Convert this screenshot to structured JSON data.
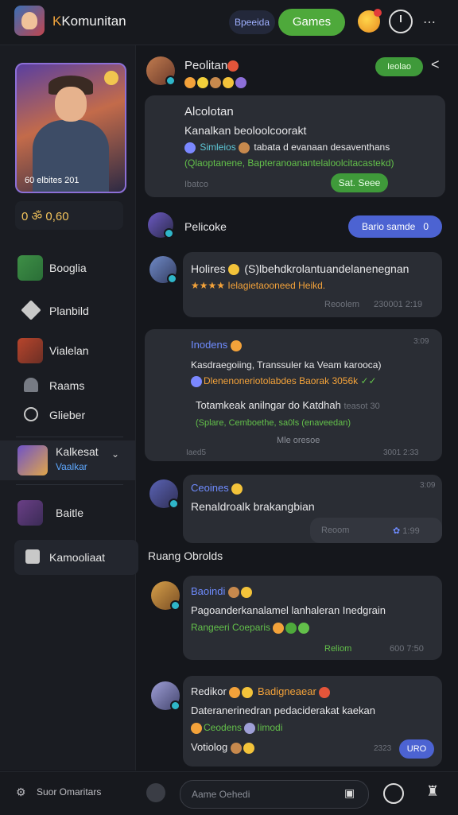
{
  "header": {
    "title": "Komunitan",
    "pill_label": "Bpeeida",
    "games_label": "Games",
    "icons": [
      "app-logo",
      "badge-icon",
      "timer-icon",
      "menu-icon"
    ],
    "accent": "#4ea93b"
  },
  "sidebar": {
    "hero_label": "60 elbites 201",
    "stats": "0 ॐ 0,60",
    "items": [
      {
        "label": "Booglia"
      },
      {
        "label": "Planbild"
      },
      {
        "label": "Vialelan"
      },
      {
        "label": "Raams"
      },
      {
        "label": "Glieber"
      },
      {
        "label": "Kalkesat",
        "sub": "Vaalkar"
      },
      {
        "label": "Baitle"
      },
      {
        "label": "Kamooliaat"
      }
    ]
  },
  "feed": {
    "post1": {
      "name": "Peolitan",
      "follow_label": "Ieolao",
      "title": "Alcolotan",
      "line1": "Kanalkan beoloolcoorakt",
      "line2a": "Simleios",
      "line2b": "tabata d evanaan desaventhans",
      "line3": "(Qlaoptanene, Bapteranoanantelaloolcitacastekd)",
      "footer_left": "Ibatco",
      "button": "Sat. Seee"
    },
    "section1": {
      "name": "Pelicoke",
      "button": "Bario samde",
      "count": "0"
    },
    "post2": {
      "name": "Holires",
      "text": "(S)lbehdkrolantuandelanenegnan",
      "sub": "Ielagietaooneed Heikd.",
      "footer_left": "Reoolem",
      "footer_right": "230001 2:19"
    },
    "post3": {
      "name": "Inodens",
      "time": "3:09",
      "line1": "Kasdraegoiing, Transsuler ka Veam karooca)",
      "line2": "Dlenenoneriotolabdes Baorak 3056k",
      "inner1": "Totamkeak anilngar do Katdhah",
      "inner1_time": "teasot 30",
      "inner2": "(Splare, Cemboethe, sa0ls (enaveedan)",
      "inner3": "Mle oresoe",
      "footer_left": "Iaed5",
      "footer_right": "3001 2:33"
    },
    "post4": {
      "name": "Ceoines",
      "time": "3:09",
      "text": "Renaldroalk brakangbian",
      "footer_left": "Reoom",
      "footer_right": "1:99"
    },
    "room_label": "Ruang Obrolds",
    "post5": {
      "name": "Baoindi",
      "text": "Pagoanderkanalamel lanhaleran Inedgrain",
      "sub": "Rangeeri Coeparis",
      "footer_left": "Reliom",
      "footer_right": "600 7:50"
    },
    "post6": {
      "name": "Redikor",
      "name2": "Badigneaear",
      "text": "Dateranerinedran pedaciderakat kaekan",
      "sub1": "Ceodens",
      "sub2": "Iimodi",
      "sub3": "Votiolog",
      "footer_right": "2323",
      "button": "URO"
    }
  },
  "bottom": {
    "left_label": "Suor Omaritars",
    "input_placeholder": "Aame Oehedi"
  }
}
